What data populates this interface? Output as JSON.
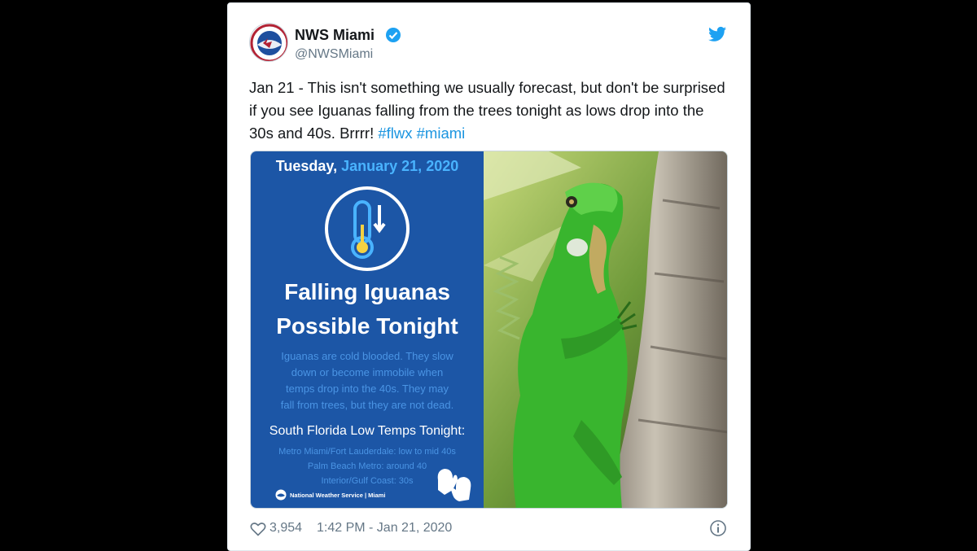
{
  "tweet": {
    "display_name": "NWS Miami",
    "handle": "@NWSMiami",
    "text_main": "Jan 21 - This isn't something we usually forecast, but don't be surprised if you see Iguanas falling from the trees tonight as lows drop into the 30s and 40s. Brrrr!",
    "hashtag_1": "#flwx",
    "hashtag_2": "#miami",
    "likes": "3,954",
    "timestamp": "1:42 PM - Jan 21, 2020"
  },
  "graphic": {
    "day": "Tuesday,",
    "date": "January 21, 2020",
    "headline_line1": "Falling Iguanas",
    "headline_line2": "Possible Tonight",
    "body_line1": "Iguanas are cold blooded. They slow",
    "body_line2": "down or become immobile when",
    "body_line3": "temps drop into the 40s. They may",
    "body_line4": "fall from trees, but they are not dead.",
    "temps_title": "South Florida Low Temps Tonight:",
    "temp_1": "Metro Miami/Fort Lauderdale: low to mid 40s",
    "temp_2": "Palm Beach Metro: around 40",
    "temp_3": "Interior/Gulf Coast: 30s",
    "footer": "National Weather Service | Miami"
  },
  "colors": {
    "graphic_bg": "#1c56a6",
    "date_highlight": "#49b3ff",
    "hashtag": "#1b95e0",
    "verified": "#1da1f2"
  },
  "icons": [
    "nws-logo-icon",
    "verified-badge-icon",
    "twitter-bird-icon",
    "thermometer-icon",
    "mittens-icon",
    "noaa-icon",
    "heart-icon",
    "info-icon"
  ]
}
